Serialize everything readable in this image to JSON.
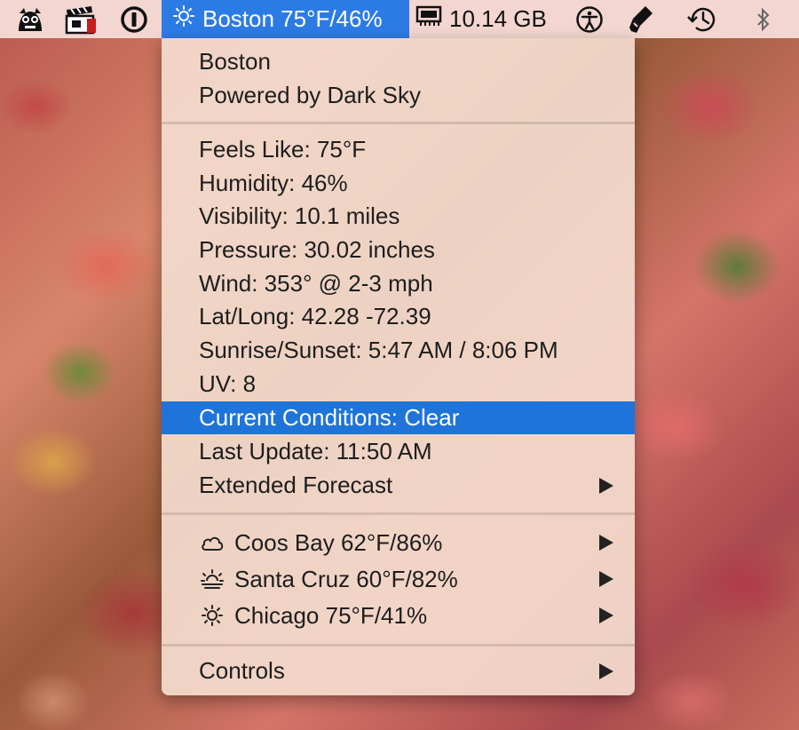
{
  "menubar": {
    "weather_status": "Boston 75°F/46%",
    "memory_label": "10.14 GB",
    "icons": [
      "gremlin-icon",
      "clapper-icon",
      "password-icon",
      "sun-icon",
      "memory-chip-icon",
      "accessibility-icon",
      "pen-icon",
      "time-machine-icon",
      "bluetooth-icon"
    ]
  },
  "menu": {
    "header": {
      "location": "Boston",
      "powered_by": "Powered by Dark Sky"
    },
    "details": [
      "Feels Like: 75°F",
      "Humidity: 46%",
      "Visibility: 10.1 miles",
      "Pressure: 30.02 inches",
      "Wind: 353° @ 2-3 mph",
      "Lat/Long: 42.28 -72.39",
      "Sunrise/Sunset: 5:47 AM / 8:06 PM",
      "UV: 8",
      "Current Conditions: Clear",
      "Last Update: 11:50 AM",
      "Extended Forecast"
    ],
    "cities": [
      {
        "label": "Coos Bay 62°F/86%",
        "icon": "cloud-icon"
      },
      {
        "label": "Santa Cruz 60°F/82%",
        "icon": "sunset-icon"
      },
      {
        "label": "Chicago 75°F/41%",
        "icon": "sun-icon"
      }
    ],
    "controls": "Controls"
  },
  "colors": {
    "highlight": "#1e74d8",
    "status_bg": "#2c7be5",
    "menubar_bg": "#f2d6cf"
  }
}
